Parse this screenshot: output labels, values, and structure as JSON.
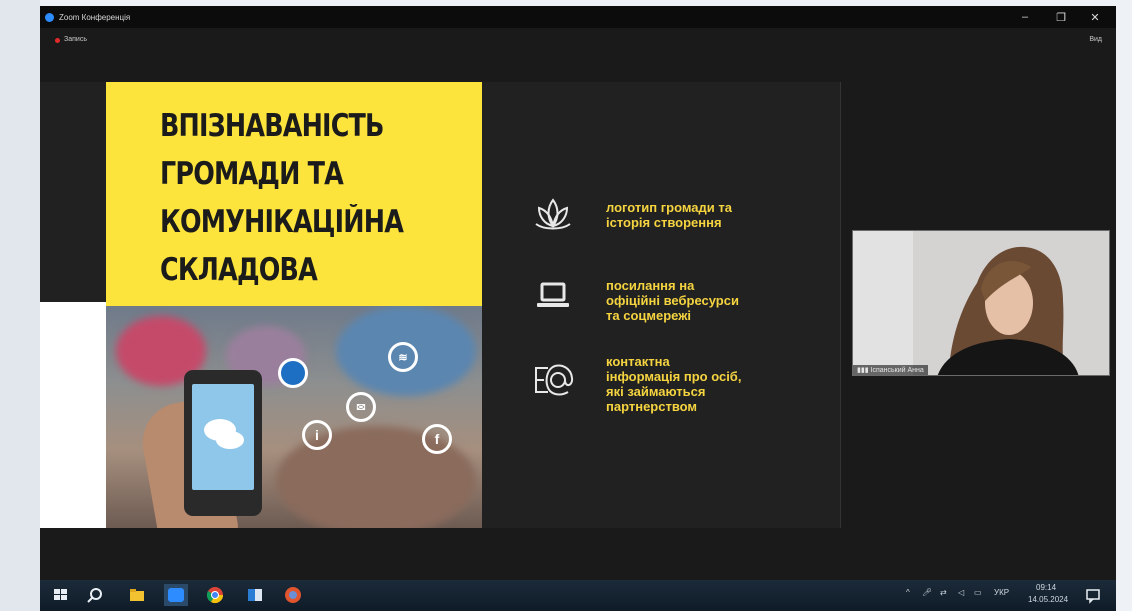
{
  "window": {
    "title": "Zoom Конференція",
    "record_label": "Запись",
    "view_label": "Вид",
    "minimize_glyph": "–",
    "maximize_glyph": "❐",
    "close_glyph": "✕"
  },
  "slide": {
    "title_lines": [
      "ВПІЗНАВАНІСТЬ",
      "ГРОМАДИ ТА",
      "КОМУНІКАЦІЙНА",
      "СКЛАДОВА"
    ],
    "bullets": [
      {
        "icon": "lotus-icon",
        "text": "логотип громади та\nісторія створення"
      },
      {
        "icon": "laptop-icon",
        "text": "посилання на\nофіційні вебресурси\nта соцмережі"
      },
      {
        "icon": "email-at-icon",
        "text": "контактна\nінформація про осіб,\nякі займаються\nпартнерством"
      }
    ],
    "photo_overlay_glyphs": {
      "info": "i",
      "facebook": "f"
    }
  },
  "participant": {
    "name": "Іспанський Анна"
  },
  "taskbar": {
    "language": "УКР",
    "time": "09:14",
    "date": "14.05.2024",
    "tray_arrow": "^"
  },
  "colors": {
    "slide_yellow": "#fde43d",
    "bullet_text": "#f5d440",
    "zoom_blue": "#2d8cff",
    "record_red": "#e02b2b"
  }
}
